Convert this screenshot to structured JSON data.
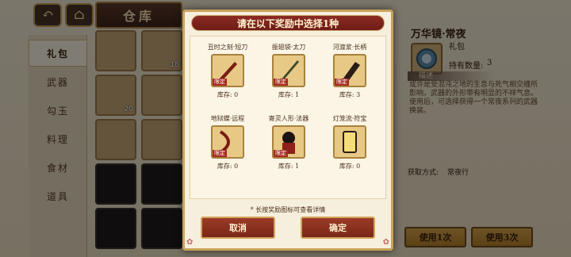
{
  "header": {
    "back_icon": "back-arrow-icon",
    "home_icon": "home-icon",
    "title": "仓库"
  },
  "sidebar": {
    "items": [
      {
        "label": "礼包"
      },
      {
        "label": "武器"
      },
      {
        "label": "勾玉"
      },
      {
        "label": "料理"
      },
      {
        "label": "食材"
      },
      {
        "label": "道具"
      }
    ]
  },
  "grid": {
    "counts": [
      "",
      "18",
      "20",
      "",
      "",
      ""
    ]
  },
  "detail": {
    "title": "万华镜·常夜",
    "type": "礼包",
    "count_label": "持有数量:",
    "count_value": "3",
    "section_title": "描述",
    "description": "或许是受混沌之地的生息与死气相交缠所影响，武器的外形带有明显的不祥气息。使用后，可选择获得一个常夜系列的武器换装。",
    "obtain_label": "获取方式:",
    "obtain_value": "常夜行",
    "use1_label": "使用1次",
    "use3_label": "使用3次"
  },
  "modal": {
    "title": "请在以下奖励中选择1种",
    "rewards": [
      {
        "name": "丑时之刻·短刀",
        "stock": "库存: 0",
        "tag": "限定"
      },
      {
        "name": "振翅袋·太刀",
        "stock": "库存: 1",
        "tag": "限定"
      },
      {
        "name": "河渡浆·长柄",
        "stock": "库存: 3",
        "tag": "限定"
      },
      {
        "name": "地狱蝶·远程",
        "stock": "库存: 0",
        "tag": "限定"
      },
      {
        "name": "寄灵人形·法器",
        "stock": "库存: 1",
        "tag": "限定"
      },
      {
        "name": "灯笼流·符宝",
        "stock": "库存: 0",
        "tag": ""
      }
    ],
    "hint": "* 长按奖励图标可查看详情",
    "cancel_label": "取消",
    "confirm_label": "确定"
  }
}
